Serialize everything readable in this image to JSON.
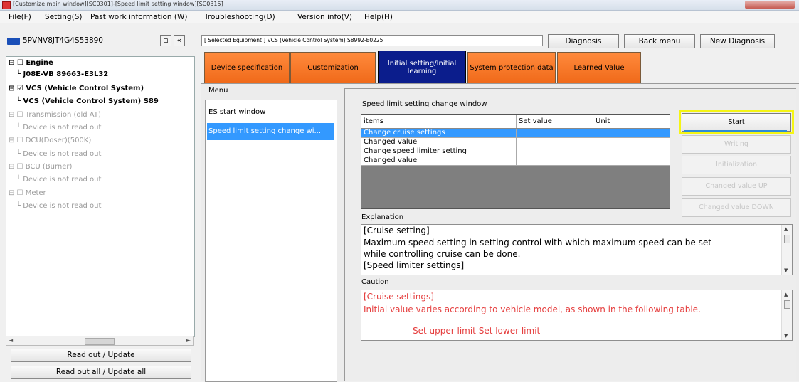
{
  "window": {
    "title": "[Customize main window][SC0301]-[Speed limit setting window][SC0315]"
  },
  "menubar": [
    "File(F)",
    "Setting(S)",
    "Past work information (W)",
    "Troubleshooting(D)",
    "Version info(V)",
    "Help(H)"
  ],
  "left": {
    "vin": "5PVNV8JT4G4S53890",
    "small_btn_1": "▫",
    "small_btn_2": "«",
    "tree": [
      {
        "label": "Engine",
        "style": "bold"
      },
      {
        "label": "J08E-VB 89663-E3L32",
        "style": "bold"
      },
      {
        "label": "VCS (Vehicle Control System)",
        "style": "bold"
      },
      {
        "label": "VCS (Vehicle Control System) S89",
        "style": "bold"
      },
      {
        "label": "Transmission (old AT)",
        "style": "gray"
      },
      {
        "label": "Device is not read out",
        "style": "gray"
      },
      {
        "label": "DCU(Doser)(500K)",
        "style": "gray"
      },
      {
        "label": "Device is not read out",
        "style": "gray"
      },
      {
        "label": "BCU (Burner)",
        "style": "gray"
      },
      {
        "label": "Device is not read out",
        "style": "gray"
      },
      {
        "label": "Meter",
        "style": "gray"
      },
      {
        "label": "Device is not read out",
        "style": "gray"
      }
    ],
    "read_out_update": "Read out / Update",
    "read_out_all": "Read out all / Update all"
  },
  "header": {
    "selected_equipment": "[ Selected Equipment ] VCS (Vehicle Control System) S8992-E0225",
    "diagnosis": "Diagnosis",
    "back_menu": "Back menu",
    "new_diagnosis": "New Diagnosis"
  },
  "tabs": [
    {
      "label": "Device specification"
    },
    {
      "label": "Customization"
    },
    {
      "label": "Initial setting/Initial learning"
    },
    {
      "label": "System protection data"
    },
    {
      "label": "Learned Value"
    }
  ],
  "menu": {
    "header": "Menu",
    "items": [
      "ES start window",
      "Speed limit setting change wi..."
    ]
  },
  "panel": {
    "title": "Speed limit setting change window",
    "columns": [
      "items",
      "Set value",
      "Unit"
    ],
    "rows": [
      [
        "Change cruise settings",
        "",
        ""
      ],
      [
        "Changed value",
        "",
        ""
      ],
      [
        "Change speed limiter setting",
        "",
        ""
      ],
      [
        "Changed value",
        "",
        ""
      ]
    ],
    "buttons": [
      "Start",
      "Writing",
      "Initialization",
      "Changed value UP",
      "Changed value DOWN"
    ],
    "explanation_label": "Explanation",
    "explanation_lines": [
      "[Cruise setting]",
      "Maximum speed setting in setting control with which maximum speed can be set",
      "while controlling cruise can be done.",
      "[Speed limiter settings]"
    ],
    "caution_label": "Caution",
    "caution_lines": [
      "[Cruise settings]",
      "Initial value varies according to vehicle model, as shown in the following table.",
      "Set upper limit  Set lower limit"
    ]
  },
  "colors": {
    "tab_orange": "#f47a2a",
    "tab_active": "#0b1d8c",
    "selection": "#3399ff",
    "highlight": "#f5f514",
    "caution_text": "#e53d3d"
  }
}
